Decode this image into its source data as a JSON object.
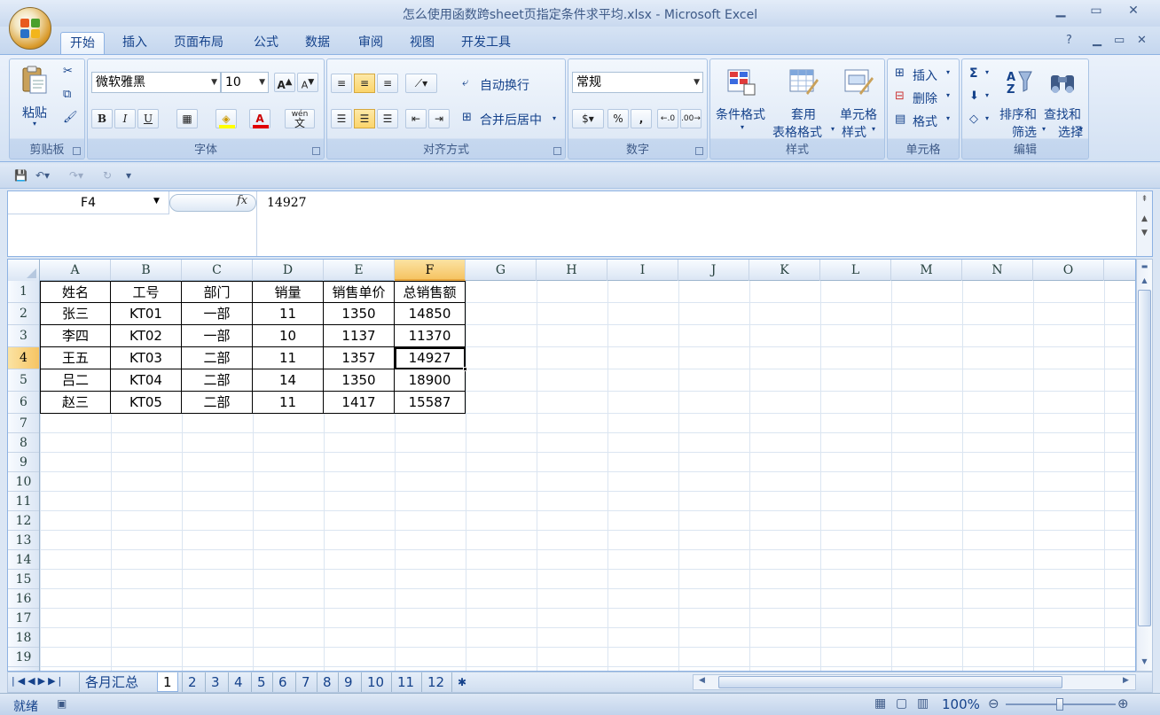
{
  "window": {
    "title": "怎么使用函数跨sheet页指定条件求平均.xlsx - Microsoft Excel",
    "minimize": "▁",
    "restore": "▭",
    "close": "✕"
  },
  "tabs": [
    "开始",
    "插入",
    "页面布局",
    "公式",
    "数据",
    "审阅",
    "视图",
    "开发工具"
  ],
  "active_tab": "开始",
  "ribbon": {
    "clipboard": {
      "label": "剪贴板",
      "paste": "粘贴"
    },
    "font": {
      "label": "字体",
      "font_name": "微软雅黑",
      "font_size": "10",
      "bold": "B",
      "italic": "I",
      "underline": "U",
      "wen": "wén",
      "wen_char": "文"
    },
    "alignment": {
      "label": "对齐方式",
      "wrap_text": "自动换行",
      "merge_center": "合并后居中"
    },
    "number": {
      "label": "数字",
      "format": "常规",
      "percent": "%",
      "comma": ","
    },
    "styles": {
      "label": "样式",
      "conditional_formatting": "条件格式",
      "format_as_table_1": "套用",
      "format_as_table_2": "表格格式",
      "cell_styles_1": "单元格",
      "cell_styles_2": "样式"
    },
    "cells": {
      "label": "单元格",
      "insert": "插入",
      "delete": "删除",
      "format": "格式"
    },
    "editing": {
      "label": "编辑",
      "sort_filter_1": "排序和",
      "sort_filter_2": "筛选",
      "find_select_1": "查找和",
      "find_select_2": "选择",
      "sigma": "Σ"
    }
  },
  "formula_bar": {
    "name_box": "F4",
    "fx": "fx",
    "content": "14927"
  },
  "grid": {
    "columns": [
      "A",
      "B",
      "C",
      "D",
      "E",
      "F",
      "G",
      "H",
      "I",
      "J",
      "K",
      "L",
      "M",
      "N",
      "O"
    ],
    "selected_column": "F",
    "rows": [
      "1",
      "2",
      "3",
      "4",
      "5",
      "6",
      "7",
      "8",
      "9",
      "10",
      "11",
      "12",
      "13",
      "14",
      "15",
      "16",
      "17",
      "18",
      "19"
    ],
    "selected_row": "4",
    "header": [
      "姓名",
      "工号",
      "部门",
      "销量",
      "销售单价",
      "总销售额"
    ],
    "data": [
      [
        "张三",
        "KT01",
        "一部",
        "11",
        "1350",
        "14850"
      ],
      [
        "李四",
        "KT02",
        "一部",
        "10",
        "1137",
        "11370"
      ],
      [
        "王五",
        "KT03",
        "二部",
        "11",
        "1357",
        "14927"
      ],
      [
        "吕二",
        "KT04",
        "二部",
        "14",
        "1350",
        "18900"
      ],
      [
        "赵三",
        "KT05",
        "二部",
        "11",
        "1417",
        "15587"
      ]
    ]
  },
  "sheets": [
    "各月汇总",
    "1",
    "2",
    "3",
    "4",
    "5",
    "6",
    "7",
    "8",
    "9",
    "10",
    "11",
    "12"
  ],
  "active_sheet": "1",
  "status": {
    "ready": "就绪",
    "zoom": "100%"
  }
}
